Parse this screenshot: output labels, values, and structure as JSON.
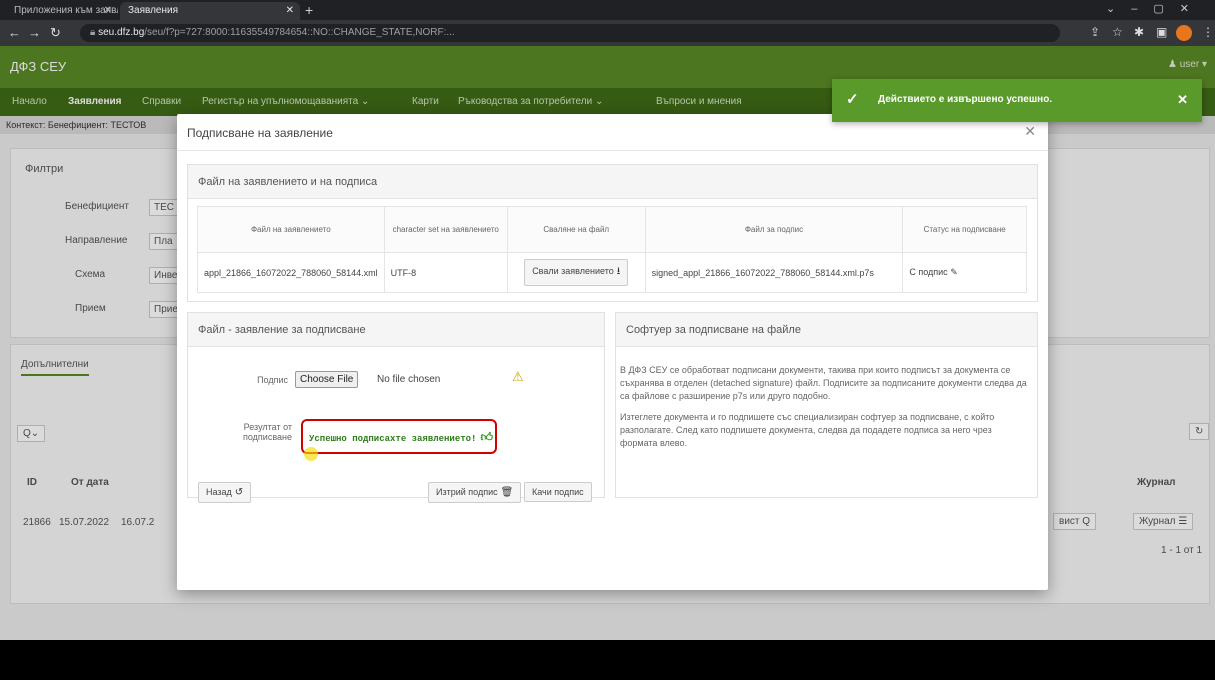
{
  "browser": {
    "tabs": [
      {
        "label": "Приложения към заявления с"
      },
      {
        "label": "Заявления"
      }
    ],
    "url_host": "seu.dfz.bg",
    "url_rest": "/seu/f?p=727:8000:11635549784654::NO::CHANGE_STATE,NORF:..."
  },
  "app": {
    "brand": "ДФЗ СЕУ",
    "user": "user",
    "nav": [
      {
        "label": "Начало"
      },
      {
        "label": "Заявления"
      },
      {
        "label": "Справки"
      },
      {
        "label": "Регистър на упълномощаванията"
      },
      {
        "label": "Карти"
      },
      {
        "label": "Ръководства за потребители"
      },
      {
        "label": "Въпроси и мнения"
      }
    ],
    "context": "Контекст: Бенефициент: ТЕСТОВ"
  },
  "background": {
    "filters_title": "Филтри",
    "filter_labels": [
      "Бенефициент",
      "Направление",
      "Схема",
      "Прием"
    ],
    "filter_values": [
      "ТЕС",
      "Пла",
      "Инве",
      "Прие"
    ],
    "tab_label": "Допълнителни",
    "search_icon": "search-icon",
    "col_id": "ID",
    "col_from": "От дата",
    "row_id": "21866",
    "row_date": "15.07.2022",
    "row_date2": "16.07.2",
    "journal_header": "Журнал",
    "journal_button": "Журнал",
    "view_button": "вист",
    "pagination": "1 - 1 от 1"
  },
  "toast": {
    "message": "Действието е извършено успешно."
  },
  "modal": {
    "title": "Подписване на заявление",
    "files_section_title": "Файл на заявлението и на подписа",
    "table": {
      "headers": [
        "Файл на заявлението",
        "character set на заявлението",
        "Сваляне на файл",
        "Файл за подпис",
        "Статус на подписване"
      ],
      "row": {
        "file": "appl_21866_16072022_788060_58144.xml",
        "charset": "UTF-8",
        "download_label": "Свали заявлението",
        "signature_file": "signed_appl_21866_16072022_788060_58144.xml.p7s",
        "status": "С подпис"
      }
    },
    "sign_section_title": "Файл - заявление за подписване",
    "signature_label": "Подпис",
    "choose_file": "Choose File",
    "no_file": "No file chosen",
    "result_label": "Резултат от подписване",
    "result_text": "Успешно подписахте заявлението!",
    "back_button": "Назад",
    "delete_button": "Изтрий подпис",
    "upload_button": "Качи подпис",
    "software_title": "Софтуер за подписване на файле",
    "software_p1": "В ДФЗ СЕУ се обработват подписани документи, такива при които подписът за документа се съхранява в отделен (detached signature) файл. Подписите за подписаните документи следва да са файлове с разширение p7s или друго подобно.",
    "software_p2": "Изтеглете документа и го подпишете със специализиран софтуер за подписване, с който разполагате. След като подпишете документа, следва да подадете подписа за него чрез формата влево."
  }
}
